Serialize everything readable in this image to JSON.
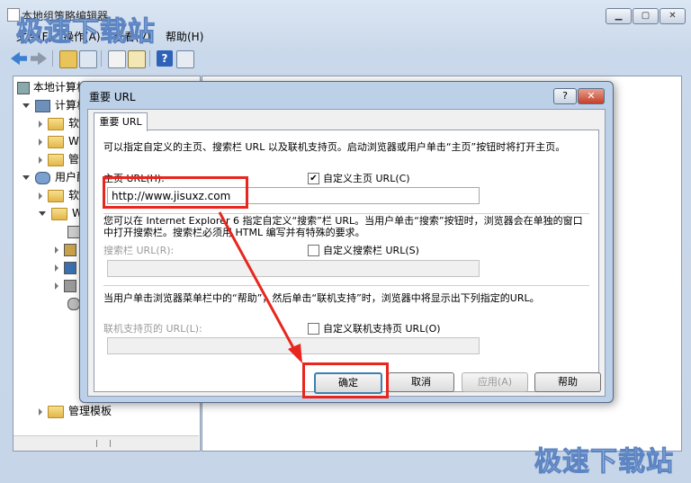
{
  "window": {
    "title": "本地组策略编辑器"
  },
  "menu": [
    "文件(F)",
    "操作(A)",
    "查看(V)",
    "帮助(H)"
  ],
  "tree": {
    "root": "本地计算机",
    "computer": "计算机",
    "user": "用户配置",
    "items": [
      "软",
      "W",
      "管",
      "软",
      "W"
    ],
    "bottom_item": "管理模板"
  },
  "dialog": {
    "title": "重要 URL",
    "tab": "重要 URL",
    "intro": "可以指定自定义的主页、搜索栏 URL 以及联机支持页。启动浏览器或用户单击“主页”按钮时将打开主页。",
    "home_label": "主页 URL(H):",
    "home_check_label": "自定义主页 URL(C)",
    "home_checked": "✔",
    "home_value": "http://www.jisuxz.com",
    "search_desc": "您可以在 Internet Explorer 6 指定自定义“搜索”栏 URL。当用户单击“搜索”按钮时，浏览器会在单独的窗口中打开搜索栏。搜索栏必须用 HTML 编写并有特殊的要求。",
    "search_label": "搜索栏 URL(R):",
    "search_check_label": "自定义搜索栏 URL(S)",
    "help_desc": "当用户单击浏览器菜单栏中的“帮助”，然后单击“联机支持”时，浏览器中将显示出下列指定的URL。",
    "support_label": "联机支持页的 URL(L):",
    "support_check_label": "自定义联机支持页 URL(O)",
    "buttons": {
      "ok": "确定",
      "cancel": "取消",
      "apply": "应用(A)",
      "help": "帮助"
    }
  },
  "watermark": "极速下载站",
  "colors": {
    "highlight_red": "#e8261e",
    "watermark_blue": "#5c84c2"
  }
}
